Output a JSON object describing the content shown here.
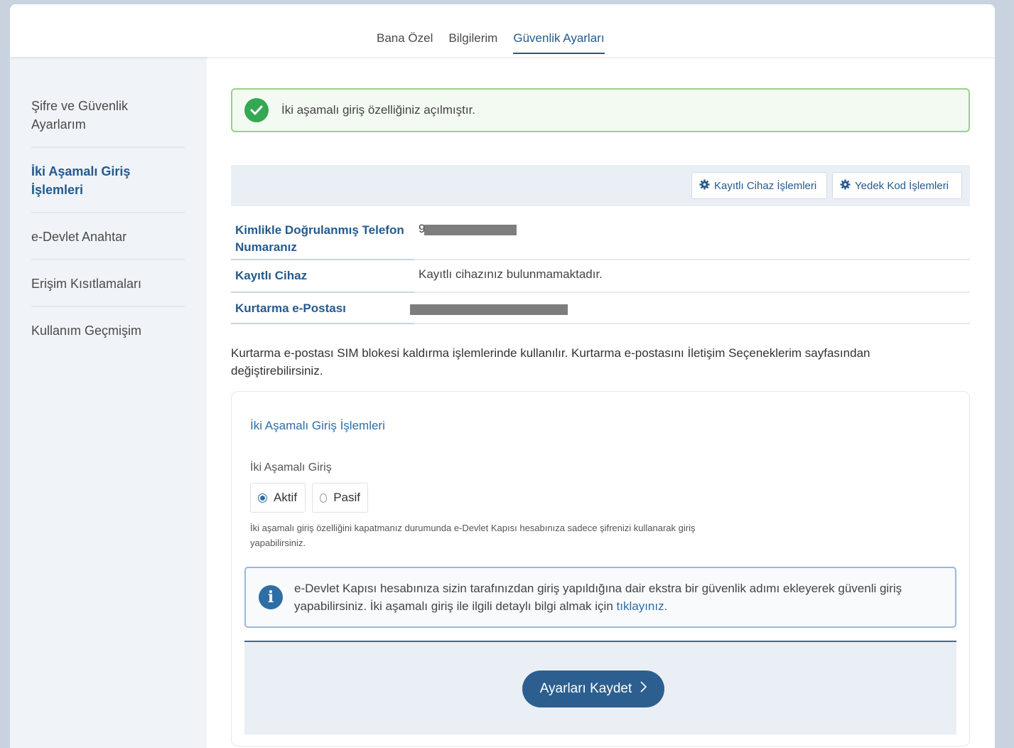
{
  "tabs": [
    {
      "label": "Bana Özel"
    },
    {
      "label": "Bilgilerim"
    },
    {
      "label": "Güvenlik Ayarları"
    }
  ],
  "sidebar": {
    "items": [
      {
        "label": "Şifre ve Güvenlik Ayarlarım"
      },
      {
        "label": "İki Aşamalı Giriş İşlemleri"
      },
      {
        "label": "e-Devlet Anahtar"
      },
      {
        "label": "Erişim Kısıtlamaları"
      },
      {
        "label": "Kullanım Geçmişim"
      }
    ]
  },
  "alert": {
    "text": "İki aşamalı giriş özelliğiniz açılmıştır."
  },
  "toolbar": {
    "device_button": "Kayıtlı Cihaz İşlemleri",
    "backup_button": "Yedek Kod İşlemleri"
  },
  "info": {
    "phone_label": "Kimlikle Doğrulanmış Telefon Numaranız",
    "phone_value_visible": "9",
    "device_label": "Kayıtlı Cihaz",
    "device_value": "Kayıtlı cihazınız bulunmamaktadır.",
    "email_label": "Kurtarma e-Postası"
  },
  "note": "Kurtarma e-postası SIM blokesi kaldırma işlemlerinde kullanılır. Kurtarma e-postasını İletişim Seçeneklerim sayfasından değiştirebilirsiniz.",
  "card": {
    "title": "İki Aşamalı Giriş İşlemleri",
    "field_label": "İki Aşamalı Giriş",
    "option_active": "Aktif",
    "option_passive": "Pasif",
    "selected": "Aktif",
    "help": "İki aşamalı giriş özelliğini kapatmanız durumunda e-Devlet Kapısı hesabınıza sadece şifrenizi kullanarak giriş yapabilirsiniz.",
    "info_text": "e-Devlet Kapısı hesabınıza sizin tarafınızdan giriş yapıldığına dair ekstra bir güvenlik adımı ekleyerek güvenli giriş yapabilirsiniz. İki aşamalı giriş ile ilgili detaylı bilgi almak için",
    "info_link": "tıklayınız.",
    "save_button": "Ayarları Kaydet"
  },
  "colors": {
    "accent": "#245a8e",
    "success": "#34a853",
    "button": "#2c5f8f"
  }
}
